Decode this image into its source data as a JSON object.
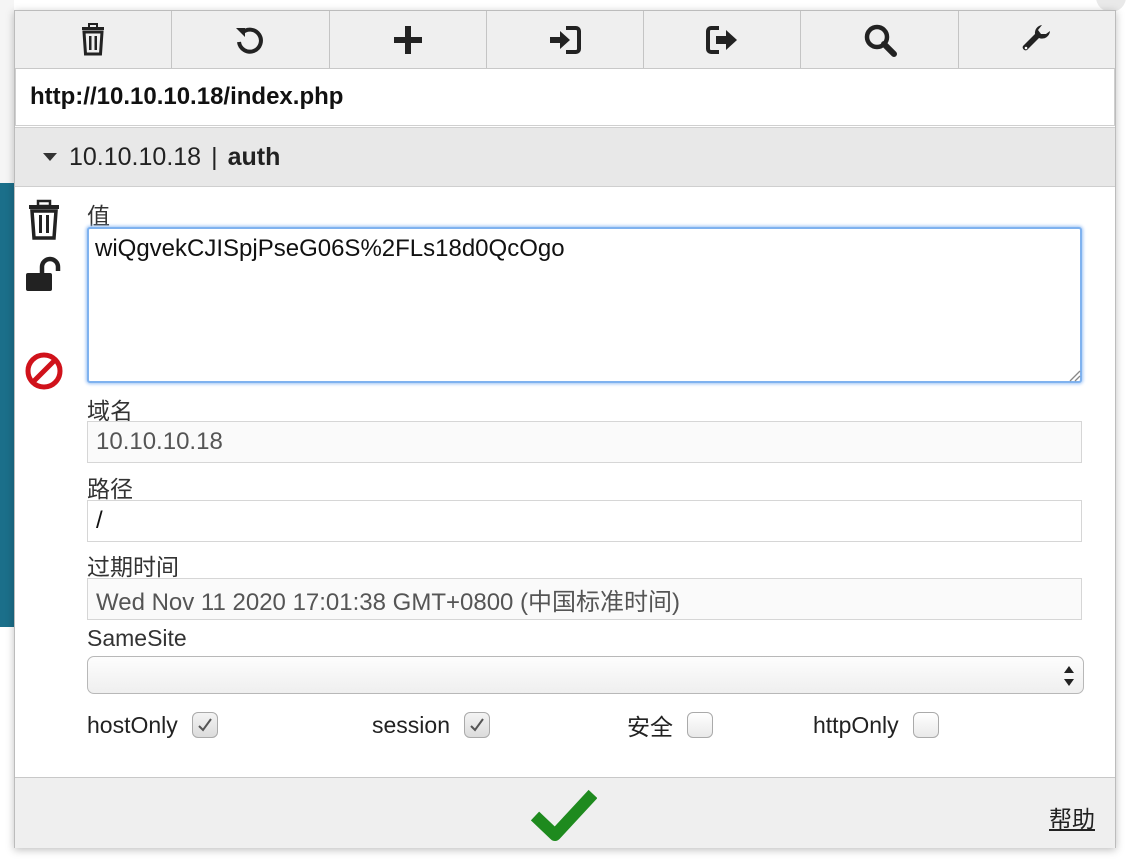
{
  "url": "http://10.10.10.18/index.php",
  "cookie_header": {
    "domain": "10.10.10.18",
    "separator": "|",
    "name": "auth"
  },
  "form": {
    "value_label": "值",
    "value": "wiQgvekCJISpjPseG06S%2FLs18d0QcOgo",
    "domain_label": "域名",
    "domain": "10.10.10.18",
    "path_label": "路径",
    "path": "/",
    "expires_label": "过期时间",
    "expires": "Wed Nov 11 2020 17:01:38 GMT+0800 (中国标准时间)",
    "samesite_label": "SameSite",
    "samesite_value": ""
  },
  "checkboxes": [
    {
      "label": "hostOnly",
      "checked": true
    },
    {
      "label": "session",
      "checked": true
    },
    {
      "label": "安全",
      "checked": false
    },
    {
      "label": "httpOnly",
      "checked": false
    }
  ],
  "footer": {
    "help_label": "帮助"
  },
  "toolbar_icons": [
    "trash-icon",
    "undo-icon",
    "plus-icon",
    "import-icon",
    "export-icon",
    "search-icon",
    "wrench-icon"
  ],
  "colors": {
    "save": "#1e8a1e",
    "block": "#d0121b",
    "focus": "#7fb2ef"
  }
}
